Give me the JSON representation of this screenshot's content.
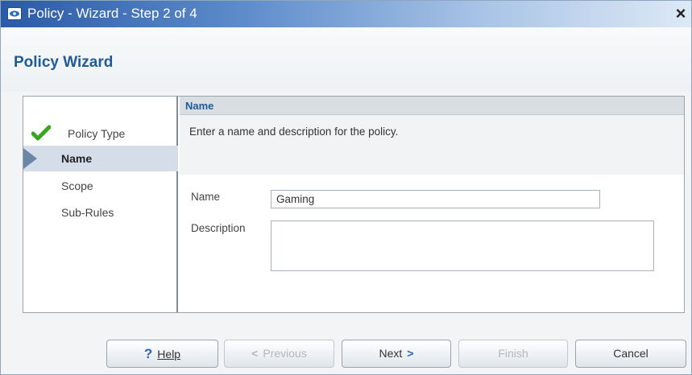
{
  "window": {
    "title": "Policy - Wizard - Step 2 of 4",
    "close_label": "×",
    "icon": "app-eye-icon"
  },
  "wizard": {
    "heading": "Policy Wizard"
  },
  "steps": [
    {
      "label": "Policy Type",
      "state": "completed",
      "icon": "checkmark-icon"
    },
    {
      "label": "Name",
      "state": "current",
      "icon": "arrow-marker-icon"
    },
    {
      "label": "Scope",
      "state": "pending"
    },
    {
      "label": "Sub-Rules",
      "state": "pending"
    }
  ],
  "panel": {
    "section_title": "Name",
    "info_text": "Enter a name and description for the policy.",
    "name_label": "Name",
    "name_value": "Gaming",
    "description_label": "Description",
    "description_value": ""
  },
  "buttons": {
    "help": {
      "label": "Help",
      "icon": "help-icon",
      "enabled": true
    },
    "previous": {
      "label": "Previous",
      "icon": "chevron-left-icon",
      "enabled": false
    },
    "next": {
      "label": "Next",
      "icon": "chevron-right-icon",
      "enabled": true
    },
    "finish": {
      "label": "Finish",
      "enabled": false
    },
    "cancel": {
      "label": "Cancel",
      "enabled": true
    }
  },
  "colors": {
    "title_bar_start": "#2b5aa6",
    "heading_blue": "#1f5a99",
    "check_green": "#3aa51f",
    "current_step_bg": "#d5dde8"
  }
}
